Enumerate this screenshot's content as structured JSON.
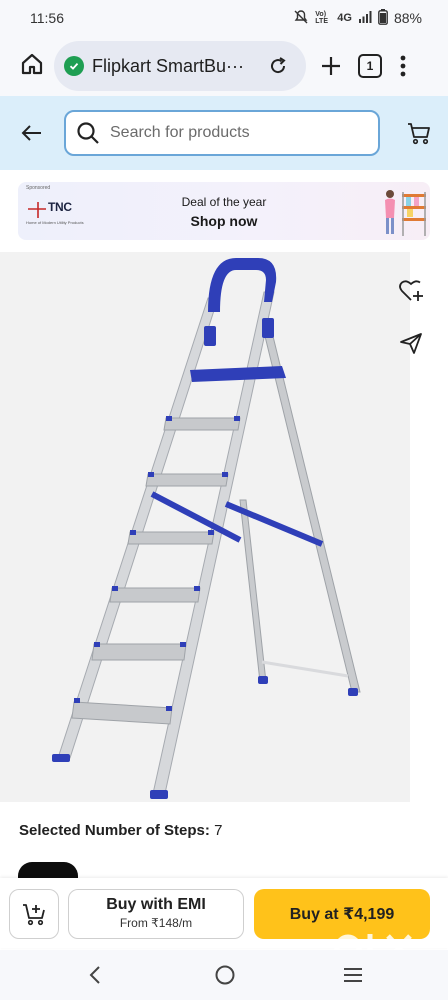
{
  "status_bar": {
    "time": "11:56",
    "network": "4G",
    "volte": "Vo) LTE",
    "battery": "88%",
    "icons": [
      "mute-icon",
      "volte-icon",
      "signal-icon",
      "battery-icon"
    ]
  },
  "browser": {
    "title": "Flipkart SmartBu···",
    "tab_count": "1",
    "icons": [
      "home-icon",
      "secure-shield-icon",
      "reload-icon",
      "plus-icon",
      "tabs-icon",
      "menu-dots-icon"
    ]
  },
  "header": {
    "search_placeholder": "Search for products",
    "icons": [
      "back-arrow-icon",
      "search-icon",
      "cart-icon"
    ],
    "background": "#dbeefa",
    "border_accent": "#6aa6d8"
  },
  "ad": {
    "sponsored_label": "Sponsored",
    "brand": "TNC",
    "brand_tagline": "Home of Modern Utility Products",
    "title": "Deal of the year",
    "cta": "Shop now"
  },
  "product": {
    "image": "aluminium-ladder-image",
    "accent_color": "#2f3fb8",
    "actions": [
      "wishlist-icon",
      "share-icon"
    ]
  },
  "variant": {
    "label": "Selected Number of Steps:",
    "value": "7"
  },
  "actions": {
    "emi_title": "Buy with EMI",
    "emi_sub": "From ₹148/m",
    "buy_label": "Buy at ₹4,199",
    "buy_color": "#ffc21a"
  },
  "watermark": {
    "text": "OLX"
  },
  "nav": {
    "icons": [
      "nav-back-icon",
      "nav-home-icon",
      "nav-recents-icon"
    ]
  }
}
